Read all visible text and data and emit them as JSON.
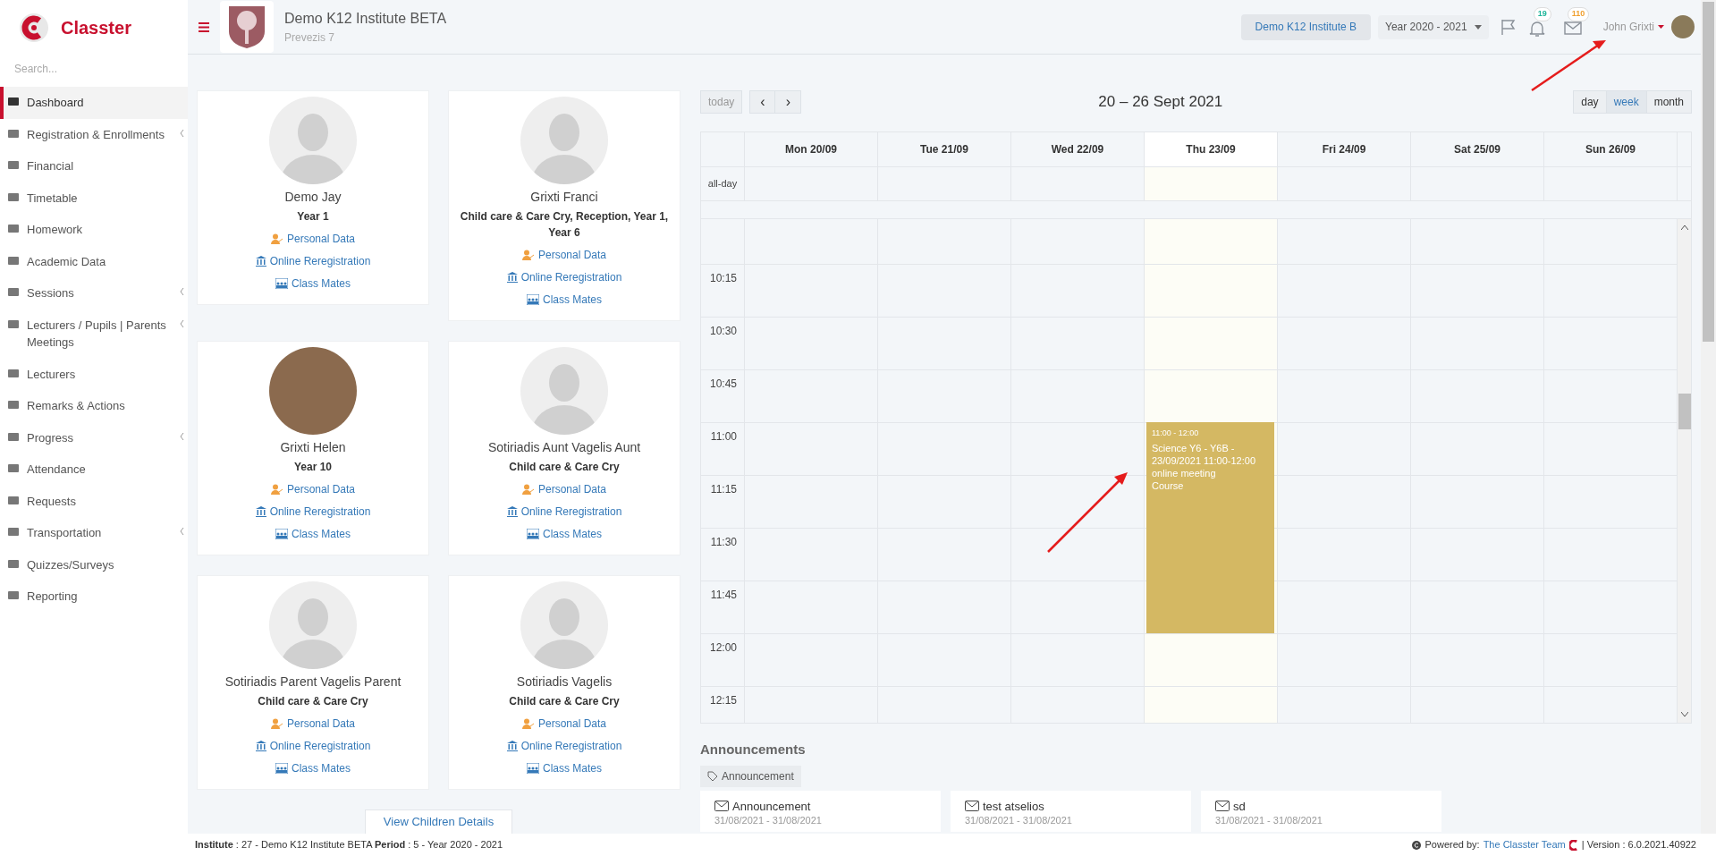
{
  "brand": {
    "name": "Classter"
  },
  "sidebar": {
    "search_placeholder": "Search...",
    "items": [
      {
        "label": "Dashboard",
        "selected": true,
        "has_submenu": false
      },
      {
        "label": "Registration & Enrollments",
        "selected": false,
        "has_submenu": true
      },
      {
        "label": "Financial",
        "selected": false,
        "has_submenu": false
      },
      {
        "label": "Timetable",
        "selected": false,
        "has_submenu": false
      },
      {
        "label": "Homework",
        "selected": false,
        "has_submenu": false
      },
      {
        "label": "Academic Data",
        "selected": false,
        "has_submenu": false
      },
      {
        "label": "Sessions",
        "selected": false,
        "has_submenu": true
      },
      {
        "label": "Lecturers / Pupils | Parents Meetings",
        "selected": false,
        "has_submenu": true
      },
      {
        "label": "Lecturers",
        "selected": false,
        "has_submenu": false
      },
      {
        "label": "Remarks & Actions",
        "selected": false,
        "has_submenu": false
      },
      {
        "label": "Progress",
        "selected": false,
        "has_submenu": true
      },
      {
        "label": "Attendance",
        "selected": false,
        "has_submenu": false
      },
      {
        "label": "Requests",
        "selected": false,
        "has_submenu": false
      },
      {
        "label": "Transportation",
        "selected": false,
        "has_submenu": true
      },
      {
        "label": "Quizzes/Surveys",
        "selected": false,
        "has_submenu": false
      },
      {
        "label": "Reporting",
        "selected": false,
        "has_submenu": false
      }
    ]
  },
  "header": {
    "institute_name": "Demo K12 Institute BETA",
    "address": "Prevezis 7",
    "institute_button": "Demo K12 Institute B",
    "year_select": "Year 2020 - 2021",
    "notifications_count": "19",
    "messages_count": "110",
    "user_name": "John Grixti"
  },
  "children": [
    {
      "name": "Demo Jay",
      "classes": "Year 1",
      "has_photo": false,
      "links": [
        "Personal Data",
        "Online Reregistration",
        "Class Mates"
      ]
    },
    {
      "name": "Grixti Franci",
      "classes": "Child care & Care Cry, Reception, Year 1, Year 6",
      "has_photo": false,
      "links": [
        "Personal Data",
        "Online Reregistration",
        "Class Mates"
      ]
    },
    {
      "name": "Grixti Helen",
      "classes": "Year 10",
      "has_photo": true,
      "links": [
        "Personal Data",
        "Online Reregistration",
        "Class Mates"
      ]
    },
    {
      "name": "Sotiriadis Aunt Vagelis Aunt",
      "classes": "Child care & Care Cry",
      "has_photo": false,
      "links": [
        "Personal Data",
        "Online Reregistration",
        "Class Mates"
      ]
    },
    {
      "name": "Sotiriadis Parent Vagelis Parent",
      "classes": "Child care & Care Cry",
      "has_photo": false,
      "links": [
        "Personal Data",
        "Online Reregistration",
        "Class Mates"
      ]
    },
    {
      "name": "Sotiriadis Vagelis",
      "classes": "Child care & Care Cry",
      "has_photo": false,
      "links": [
        "Personal Data",
        "Online Reregistration",
        "Class Mates"
      ]
    }
  ],
  "view_children_button": "View Children Details",
  "calendar": {
    "today_button": "today",
    "prev": "‹",
    "next": "›",
    "title": "20 – 26 Sept 2021",
    "views": [
      {
        "label": "day",
        "selected": false
      },
      {
        "label": "week",
        "selected": true
      },
      {
        "label": "month",
        "selected": false
      }
    ],
    "all_day_label": "all-day",
    "times": [
      "10:15",
      "10:30",
      "10:45",
      "11:00",
      "11:15",
      "11:30",
      "11:45",
      "12:00",
      "12:15"
    ],
    "days": [
      {
        "label": "Mon 20/09",
        "today": false
      },
      {
        "label": "Tue 21/09",
        "today": false
      },
      {
        "label": "Wed 22/09",
        "today": false
      },
      {
        "label": "Thu 23/09",
        "today": true,
        "events": [
          {
            "time": "11:00 - 12:00",
            "title": "Science Y6 - Y6B - 23/09/2021 11:00-12:00",
            "lines": [
              "online meeting",
              "Course"
            ],
            "color": "#d4b863"
          }
        ]
      },
      {
        "label": "Fri 24/09",
        "today": false
      },
      {
        "label": "Sat 25/09",
        "today": false
      },
      {
        "label": "Sun 26/09",
        "today": false
      }
    ]
  },
  "announcements": {
    "title": "Announcements",
    "tag": "Announcement",
    "items": [
      {
        "title": "Announcement",
        "dates": "31/08/2021 - 31/08/2021"
      },
      {
        "title": "test atselios",
        "dates": "31/08/2021 - 31/08/2021"
      },
      {
        "title": "sd",
        "dates": "31/08/2021 - 31/08/2021"
      }
    ]
  },
  "footer": {
    "info": "**Institute** : 27 - Demo K12 Institute BETA **Period** : 5 - Year 2020 - 2021",
    "powered_by": "Powered by:",
    "team_link": "The Classter Team",
    "version": "| Version : 6.0.2021.40922"
  }
}
